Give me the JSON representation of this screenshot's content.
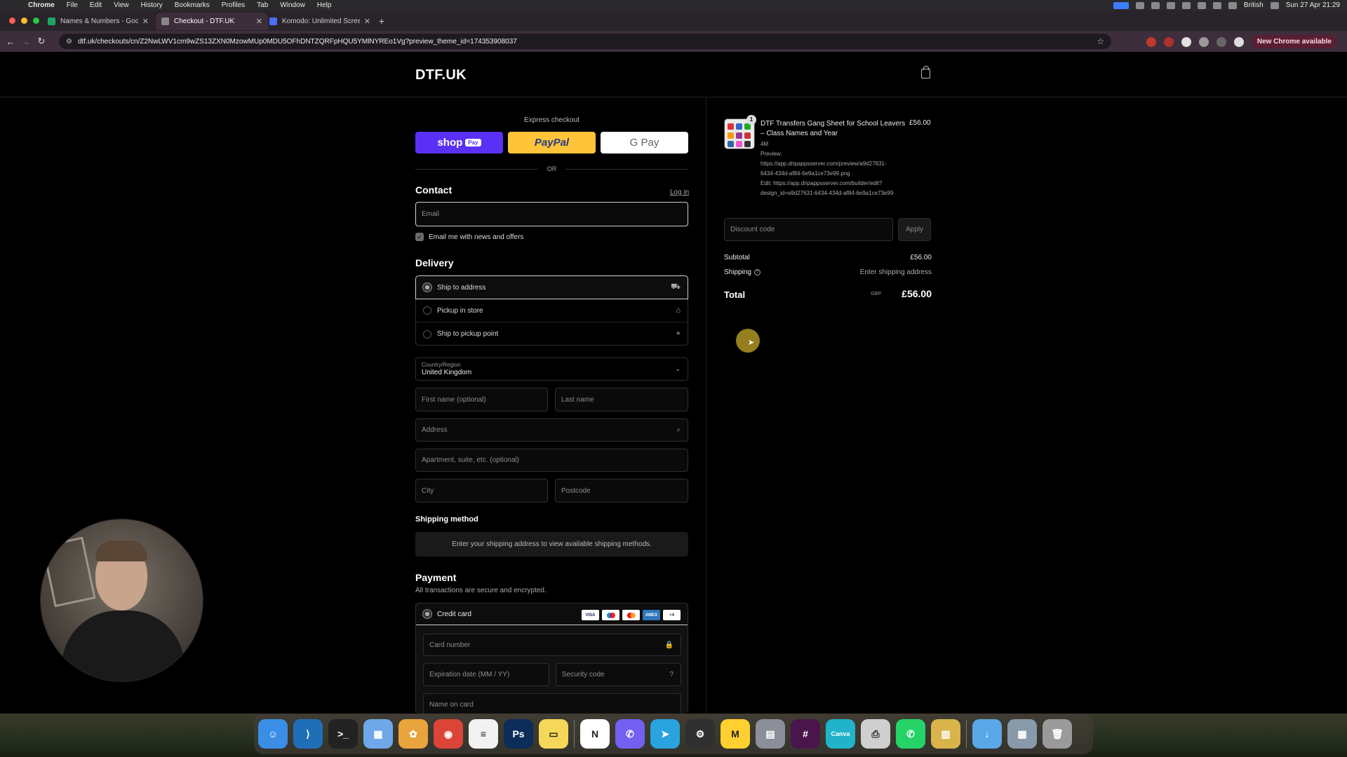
{
  "menubar": {
    "apple": "",
    "items": [
      "Chrome",
      "File",
      "Edit",
      "View",
      "History",
      "Bookmarks",
      "Profiles",
      "Tab",
      "Window",
      "Help"
    ],
    "input_source": "British",
    "clock": "Sun 27 Apr  21:29"
  },
  "browser": {
    "tabs": [
      {
        "label": "Names & Numbers - Google S",
        "favicon_color": "#1fa463"
      },
      {
        "label": "Checkout - DTF.UK",
        "favicon_color": "#888888"
      },
      {
        "label": "Komodo: Unlimited Screen Re",
        "favicon_color": "#4c6ef5"
      }
    ],
    "url": "dtf.uk/checkouts/cn/Z2NwLWV1cm9wZS13ZXN0MzowMUp0MDU5OFhDNTZQRFpHQU5YMlNYREo1Vg?preview_theme_id=174353908037",
    "new_chrome": "New Chrome available"
  },
  "store": {
    "logo": "DTF.UK"
  },
  "express": {
    "label": "Express checkout",
    "shop_pay": "shop",
    "shop_pay_pill": "Pay",
    "paypal": "PayPal",
    "gpay": "G Pay",
    "or": "OR"
  },
  "contact": {
    "title": "Contact",
    "login": "Log in",
    "email_placeholder": "Email",
    "news_checkbox": "Email me with news and offers"
  },
  "delivery": {
    "title": "Delivery",
    "options": [
      {
        "label": "Ship to address",
        "icon": "truck-icon",
        "selected": true
      },
      {
        "label": "Pickup in store",
        "icon": "store-icon",
        "selected": false
      },
      {
        "label": "Ship to pickup point",
        "icon": "location-pin-icon",
        "selected": false
      }
    ],
    "country_label": "Country/Region",
    "country_value": "United Kingdom",
    "first_name": "First name (optional)",
    "last_name": "Last name",
    "address": "Address",
    "apartment": "Apartment, suite, etc. (optional)",
    "city": "City",
    "postcode": "Postcode"
  },
  "shipping_method": {
    "title": "Shipping method",
    "note": "Enter your shipping address to view available shipping methods."
  },
  "payment": {
    "title": "Payment",
    "subtitle": "All transactions are secure and encrypted.",
    "method": "Credit card",
    "brands": [
      "VISA",
      "Maestro",
      "MC",
      "AMEX",
      "+4"
    ],
    "card_number": "Card number",
    "expiry": "Expiration date (MM / YY)",
    "security": "Security code",
    "name_on_card": "Name on card"
  },
  "summary": {
    "qty": "1",
    "product_title": "DTF Transfers Gang Sheet for School Leavers – Class Names and Year",
    "product_price": "£56.00",
    "meta_size": "4M",
    "meta_preview_label": "Preview:",
    "meta_preview": "https://app.dripappsserver.com/preview/a9d27631-6434-434d-af84-6e9a1ce73e99.png",
    "meta_edit": "Edit: https://app.dripappsserver.com/builder/edit?design_id=a9d27631-6434-434d-af84-6e9a1ce73e99",
    "discount_placeholder": "Discount code",
    "apply": "Apply",
    "subtotal_label": "Subtotal",
    "subtotal_value": "£56.00",
    "shipping_label": "Shipping",
    "shipping_value": "Enter shipping address",
    "total_label": "Total",
    "total_currency": "GBP",
    "total_value": "£56.00"
  },
  "dock": {
    "apps": [
      {
        "name": "finder",
        "color": "#3a8ee6",
        "glyph": "☺"
      },
      {
        "name": "vscode",
        "color": "#1f6fb8",
        "glyph": "⟩"
      },
      {
        "name": "terminal",
        "color": "#222222",
        "glyph": ">_"
      },
      {
        "name": "calendar-app",
        "color": "#6fa8e8",
        "glyph": "▦"
      },
      {
        "name": "photos",
        "color": "#e9a43c",
        "glyph": "✿"
      },
      {
        "name": "chrome",
        "color": "#db4437",
        "glyph": "◉"
      },
      {
        "name": "reminders",
        "color": "#f2f2f2",
        "glyph": "≡"
      },
      {
        "name": "photoshop",
        "color": "#0c2c5a",
        "glyph": "Ps"
      },
      {
        "name": "notes",
        "color": "#f5d85a",
        "glyph": "▭"
      },
      {
        "name": "notion",
        "color": "#ffffff",
        "glyph": "N"
      },
      {
        "name": "viber",
        "color": "#7360f2",
        "glyph": "✆"
      },
      {
        "name": "telegram",
        "color": "#2aa3df",
        "glyph": "➤"
      },
      {
        "name": "chatgpt",
        "color": "#2f2f2f",
        "glyph": "⚙"
      },
      {
        "name": "miro",
        "color": "#ffd02f",
        "glyph": "M"
      },
      {
        "name": "preview",
        "color": "#8a8f99",
        "glyph": "▤"
      },
      {
        "name": "slack",
        "color": "#4a154b",
        "glyph": "#"
      },
      {
        "name": "canva",
        "color": "#20b3c9",
        "glyph": "Canva"
      },
      {
        "name": "printer",
        "color": "#cfcfcf",
        "glyph": "⎙"
      },
      {
        "name": "whatsapp",
        "color": "#25d366",
        "glyph": "✆"
      },
      {
        "name": "archive",
        "color": "#d9b44a",
        "glyph": "▥"
      },
      {
        "name": "downloads-folder",
        "color": "#5aa8e8",
        "glyph": "↓"
      },
      {
        "name": "screenshots-stack",
        "color": "#8899aa",
        "glyph": "▦"
      },
      {
        "name": "trash",
        "color": "#9a9a9a",
        "glyph": "🗑"
      }
    ]
  },
  "colors": {
    "shop_pay": "#5a31f4",
    "paypal": "#ffc439",
    "page_bg": "#000000",
    "toolbar": "#3d2e3c"
  }
}
